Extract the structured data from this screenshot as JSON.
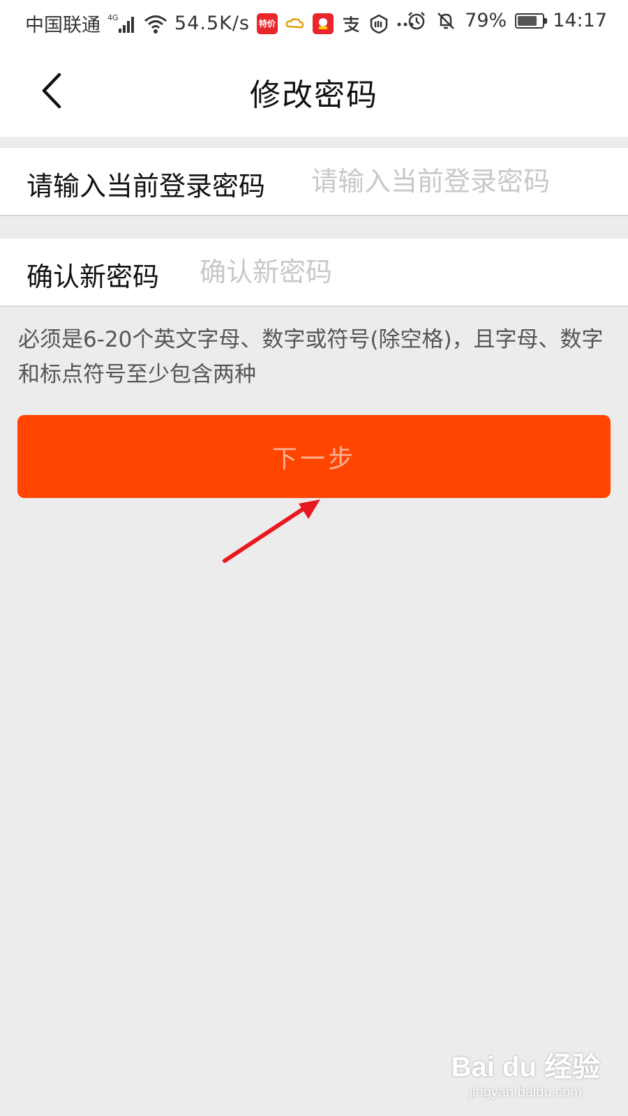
{
  "status_bar": {
    "carrier": "中国联通",
    "network_type": "4G",
    "speed": "54.5K/s",
    "app_badge_1": "特价",
    "battery_percent": "79%",
    "battery_level": 0.79,
    "time": "14:17",
    "icons": [
      "signal-icon",
      "wifi-icon",
      "cloud-icon",
      "alipay-icon",
      "shield-icon",
      "more-icon",
      "alarm-icon",
      "mute-icon",
      "battery-icon"
    ]
  },
  "nav": {
    "title": "修改密码",
    "back_icon": "chevron-left-icon"
  },
  "form": {
    "current_password": {
      "label": "请输入当前登录密码",
      "placeholder": "请输入当前登录密码",
      "value": ""
    },
    "confirm_password": {
      "label": "确认新密码",
      "placeholder": "确认新密码",
      "value": ""
    }
  },
  "hint": "必须是6-20个英文字母、数字或符号(除空格)，且字母、数字和标点符号至少包含两种",
  "next_button": {
    "label": "下一步",
    "color": "#ff4500",
    "text_color": "#ffb198"
  },
  "annotation": {
    "arrow_color": "#e8191e"
  },
  "watermark": {
    "logo": "Bai du 经验",
    "url": "jingyan.baidu.com"
  }
}
